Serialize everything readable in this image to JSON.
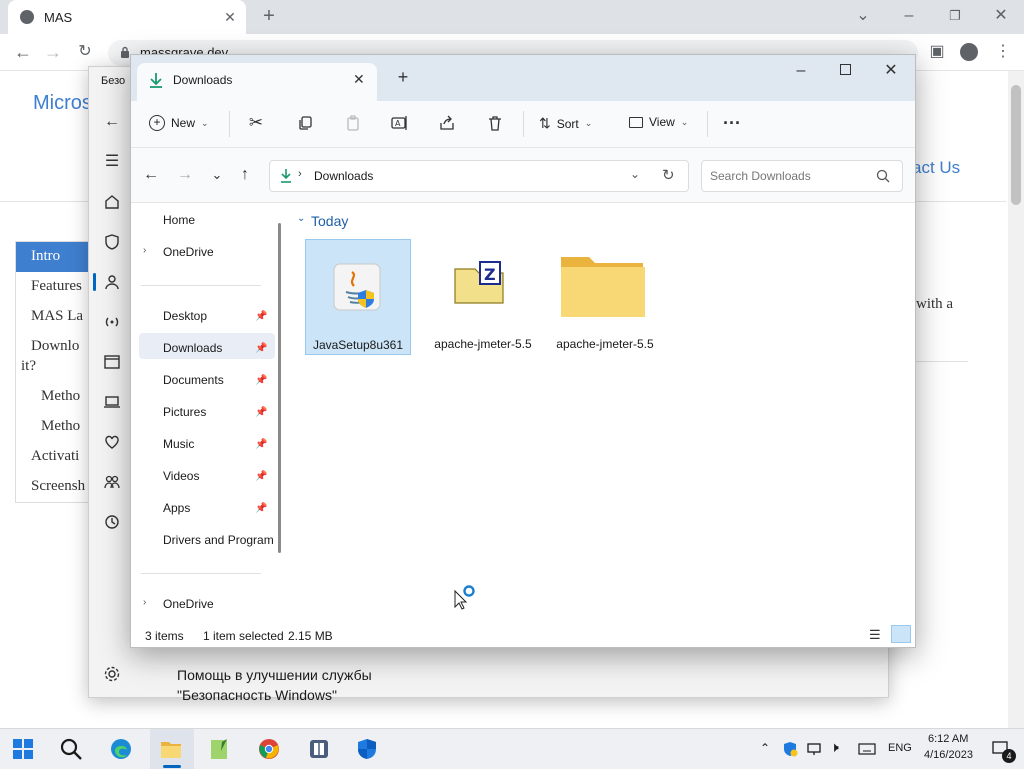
{
  "browser": {
    "tab_title": "MAS",
    "url": "massgrave.dev"
  },
  "webpage": {
    "site_title": "Micros",
    "contact": "act Us",
    "body_fragment": "with a",
    "nav": [
      "Intro",
      "Features",
      "MAS La",
      "Downlo",
      "it?",
      "Metho",
      "Metho",
      "Activati",
      "Screensh"
    ]
  },
  "security_window": {
    "title_fragment": "Безо",
    "bottom_text_line1": "Помощь в улучшении службы",
    "bottom_text_line2": "\"Безопасность Windows\""
  },
  "explorer": {
    "tab_title": "Downloads",
    "toolbar": {
      "new_label": "New",
      "sort_label": "Sort",
      "view_label": "View"
    },
    "address": {
      "path": "Downloads",
      "search_placeholder": "Search Downloads"
    },
    "nav": {
      "home": "Home",
      "onedrive": "OneDrive",
      "desktop": "Desktop",
      "downloads": "Downloads",
      "documents": "Documents",
      "pictures": "Pictures",
      "music": "Music",
      "videos": "Videos",
      "apps": "Apps",
      "drivers": "Drivers and Programs",
      "onedrive2": "OneDrive"
    },
    "group_header": "Today",
    "files": [
      {
        "name": "JavaSetup8u361",
        "icon": "java-installer-icon",
        "selected": true
      },
      {
        "name": "apache-jmeter-5.5",
        "icon": "zip-archive-icon",
        "selected": false
      },
      {
        "name": "apache-jmeter-5.5",
        "icon": "folder-icon",
        "selected": false
      }
    ],
    "status": {
      "count": "3 items",
      "selection": "1 item selected",
      "size": "2.15 MB"
    }
  },
  "taskbar": {
    "language": "ENG",
    "time": "6:12 AM",
    "date": "4/16/2023",
    "notification_count": "4"
  },
  "colors": {
    "accent": "#0067c0",
    "selection": "#cce4f7",
    "folder": "#f8d775",
    "web_nav_active": "#3f7fd0"
  }
}
